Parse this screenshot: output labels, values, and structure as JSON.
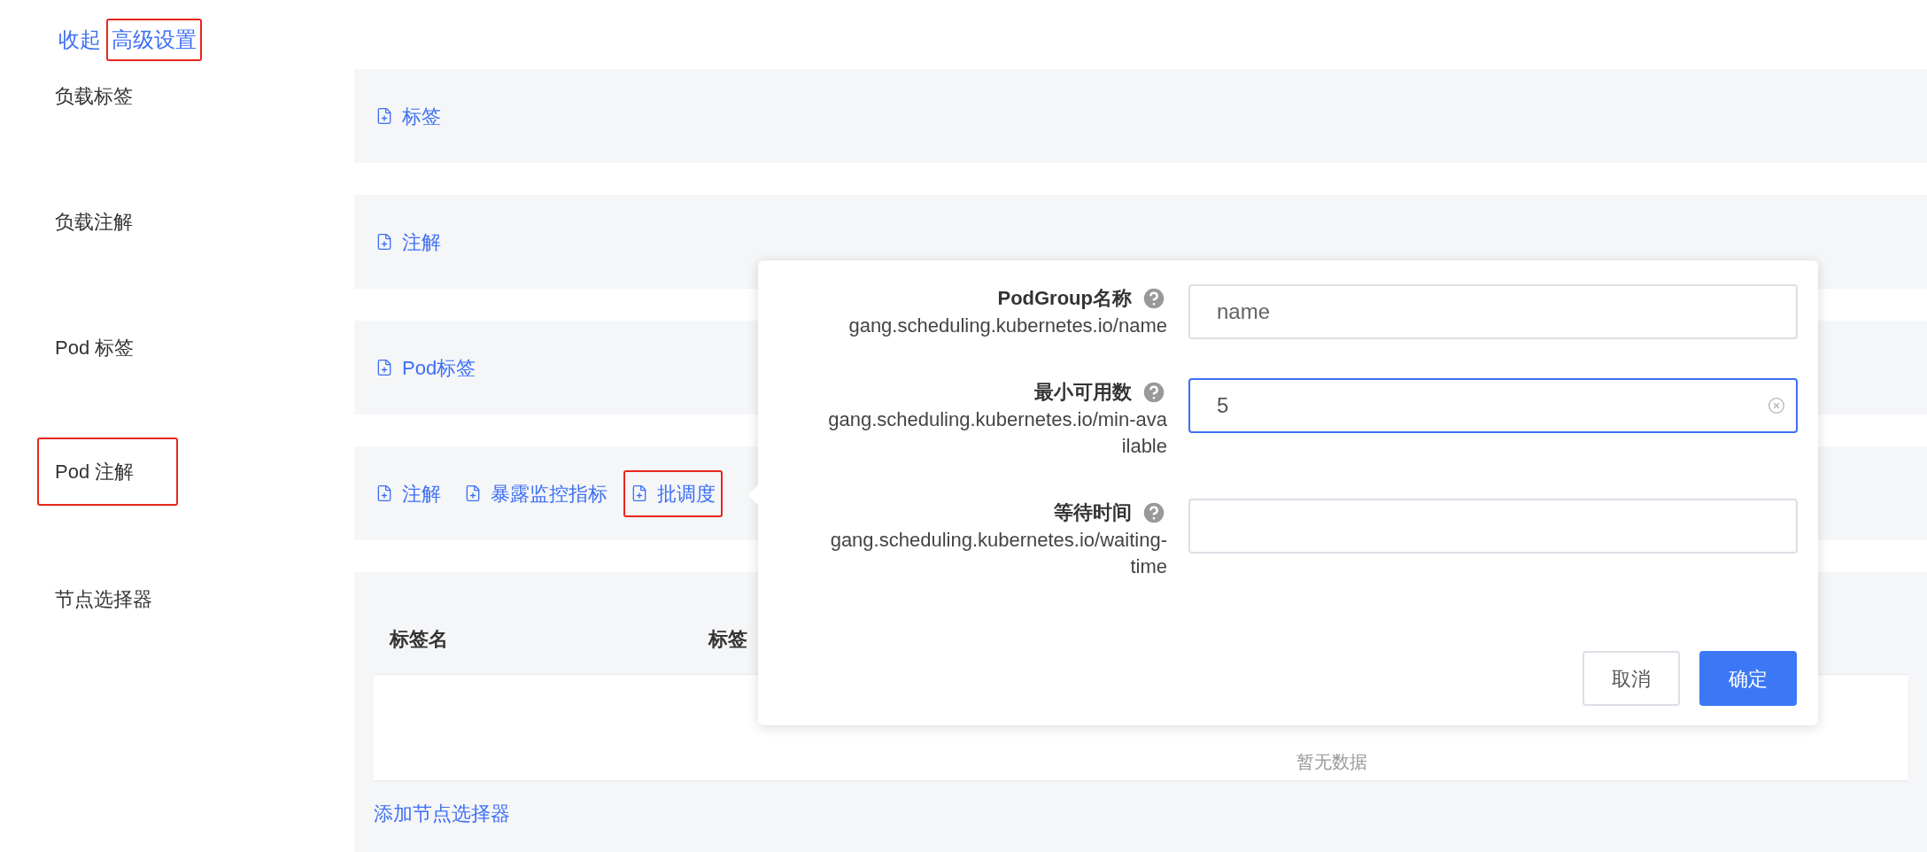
{
  "header_links": [
    {
      "label": "收起",
      "highlighted": false
    },
    {
      "label": "高级设置",
      "highlighted": true
    }
  ],
  "sections": [
    {
      "label": "负载标签",
      "highlighted": false,
      "kind": "buttons",
      "buttons": [
        {
          "label": "标签",
          "highlighted": false
        }
      ]
    },
    {
      "label": "负载注解",
      "highlighted": false,
      "kind": "buttons",
      "buttons": [
        {
          "label": "注解",
          "highlighted": false
        }
      ]
    },
    {
      "label": "Pod 标签",
      "highlighted": false,
      "kind": "buttons",
      "buttons": [
        {
          "label": "Pod标签",
          "highlighted": false
        }
      ]
    },
    {
      "label": "Pod 注解",
      "highlighted": true,
      "kind": "buttons",
      "buttons": [
        {
          "label": "注解",
          "highlighted": false
        },
        {
          "label": "暴露监控指标",
          "highlighted": false
        },
        {
          "label": "批调度",
          "highlighted": true
        }
      ]
    },
    {
      "label": "节点选择器",
      "highlighted": false,
      "kind": "table",
      "columns": [
        "标签名",
        "标签"
      ],
      "empty_text": "暂无数据",
      "add_link": "添加节点选择器"
    }
  ],
  "popover": {
    "fields": [
      {
        "label": "PodGroup名称",
        "key": "gang.scheduling.kubernetes.io/name",
        "placeholder": "name",
        "focused": false
      },
      {
        "label": "最小可用数",
        "key": "gang.scheduling.kubernetes.io/min-available",
        "value": "5",
        "focused": true
      },
      {
        "label": "等待时间",
        "key": "gang.scheduling.kubernetes.io/waiting-time",
        "focused": false
      }
    ],
    "buttons": [
      {
        "label": "取消",
        "kind": "secondary"
      },
      {
        "label": "确定",
        "kind": "primary"
      }
    ]
  }
}
